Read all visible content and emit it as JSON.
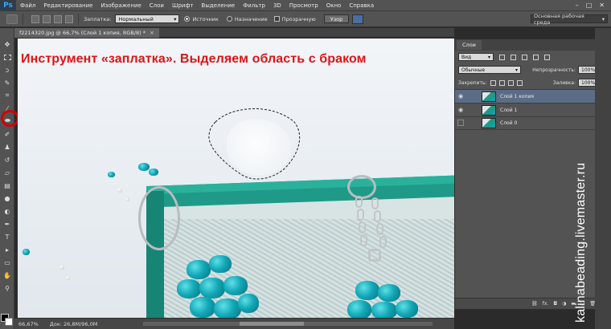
{
  "app": {
    "logo": "Ps"
  },
  "menu": [
    "Файл",
    "Редактирование",
    "Изображение",
    "Слои",
    "Шрифт",
    "Выделение",
    "Фильтр",
    "3D",
    "Просмотр",
    "Окно",
    "Справка"
  ],
  "window_controls": [
    "–",
    "□",
    "✕"
  ],
  "options": {
    "patch_label": "Заплатка:",
    "patch_mode": "Нормальный",
    "radio_source": "Источник",
    "radio_destination": "Назначение",
    "checkbox_transparent": "Прозрачную",
    "pattern_button": "Узор",
    "workspace": "Основная рабочая среда"
  },
  "document": {
    "tab_title": "f2214320.jpg @ 66,7% (Слой 1 копия, RGB/8) *",
    "close": "×"
  },
  "headline": "Инструмент «заплатка». Выделяем область с браком",
  "layers_panel": {
    "tab": "Слои",
    "filter": "Вид",
    "blend_mode": "Обычные",
    "opacity_label": "Непрозрачность:",
    "opacity_value": "100%",
    "lock_label": "Закрепить:",
    "fill_label": "Заливка:",
    "fill_value": "100%",
    "layers": [
      {
        "name": "Слой 1 копия",
        "visible": true,
        "active": true
      },
      {
        "name": "Слой 1",
        "visible": true,
        "active": false
      },
      {
        "name": "Слой 0",
        "visible": false,
        "active": false
      }
    ],
    "footer_icons": [
      "link-icon",
      "fx-icon",
      "mask-icon",
      "adjustment-icon",
      "folder-icon",
      "new-layer-icon",
      "trash-icon"
    ],
    "footer_fx": "fx."
  },
  "status": {
    "zoom": "66,67%",
    "doc_size": "Док: 26,8M/96,0M"
  },
  "watermark": "kalinabeading.livemaster.ru",
  "colors": {
    "headline": "#dd1414",
    "highlight_circle": "#d40000",
    "active_layer": "#5b6c87"
  }
}
